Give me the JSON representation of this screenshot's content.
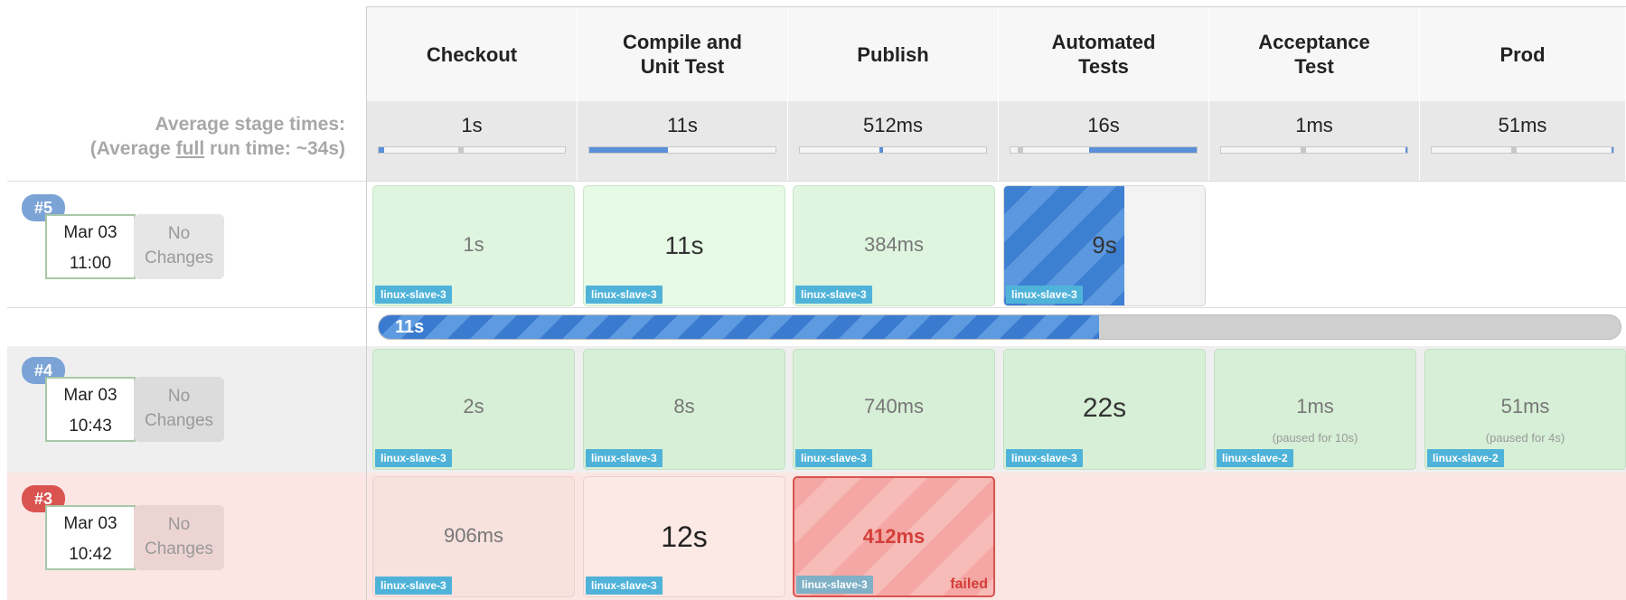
{
  "stages": [
    {
      "name": "Checkout",
      "avg": "1s",
      "avg_pct": 0.03
    },
    {
      "name": "Compile and\nUnit Test",
      "avg": "11s",
      "avg_pct": 0.42
    },
    {
      "name": "Publish",
      "avg": "512ms",
      "avg_pct": 0.02
    },
    {
      "name": "Automated\nTests",
      "avg": "16s",
      "avg_pct": 0.58
    },
    {
      "name": "Acceptance\nTest",
      "avg": "1ms",
      "avg_pct": 0.01
    },
    {
      "name": "Prod",
      "avg": "51ms",
      "avg_pct": 0.01
    }
  ],
  "average": {
    "line1": "Average stage times:",
    "line2_prefix": "(Average ",
    "line2_full": "full",
    "line2_suffix": " run time: ~34s)"
  },
  "builds": [
    {
      "number": "#5",
      "date": "Mar 03",
      "time": "11:00",
      "changes": "No\nChanges",
      "cells": [
        {
          "time": "1s",
          "agent": "linux-slave-3"
        },
        {
          "time": "11s",
          "agent": "linux-slave-3"
        },
        {
          "time": "384ms",
          "agent": "linux-slave-3"
        },
        {
          "time": "9s",
          "agent": "linux-slave-3",
          "progress": 0.6
        }
      ],
      "run_progress": {
        "label": "11s",
        "fraction": 0.58
      }
    },
    {
      "number": "#4",
      "date": "Mar 03",
      "time": "10:43",
      "changes": "No\nChanges",
      "cells": [
        {
          "time": "2s",
          "agent": "linux-slave-3"
        },
        {
          "time": "8s",
          "agent": "linux-slave-3"
        },
        {
          "time": "740ms",
          "agent": "linux-slave-3"
        },
        {
          "time": "22s",
          "agent": "linux-slave-3"
        },
        {
          "time": "1ms",
          "agent": "linux-slave-2",
          "note": "(paused for 10s)"
        },
        {
          "time": "51ms",
          "agent": "linux-slave-2",
          "note": "(paused for 4s)"
        }
      ]
    },
    {
      "number": "#3",
      "date": "Mar 03",
      "time": "10:42",
      "changes": "No\nChanges",
      "cells": [
        {
          "time": "906ms",
          "agent": "linux-slave-3"
        },
        {
          "time": "12s",
          "agent": "linux-slave-3"
        },
        {
          "time": "412ms",
          "agent": "linux-slave-3",
          "status": "failed"
        }
      ]
    }
  ],
  "colors": {
    "badge_blue": "#7ba3d6",
    "badge_red": "#d9534f",
    "success_bg": "#dff5df",
    "failed_bg": "#fbe3e0",
    "running": "#3d7fd1",
    "agent": "#4fb3d9"
  }
}
